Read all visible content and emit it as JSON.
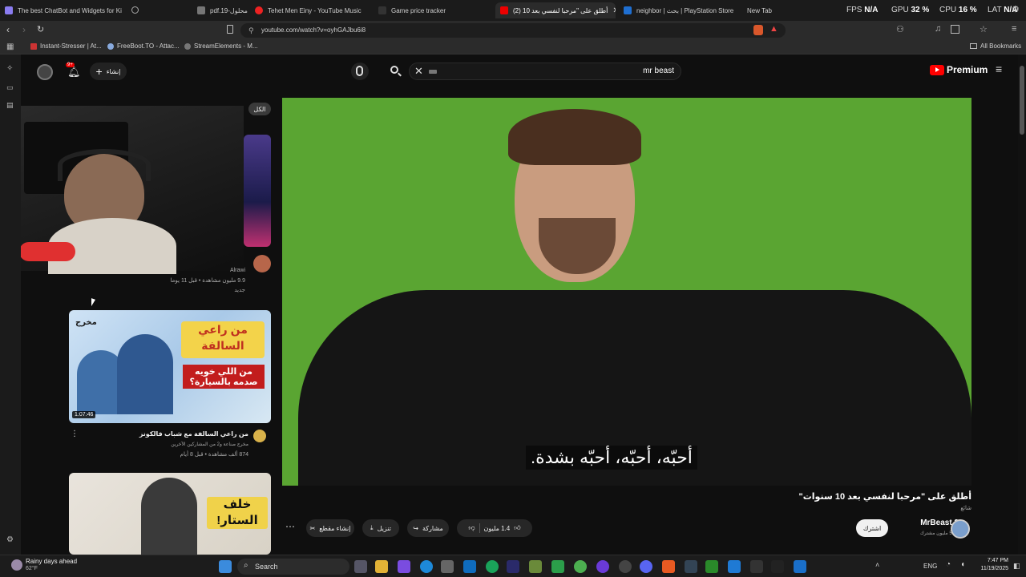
{
  "tabs": [
    {
      "label": "The best ChatBot and Widgets for Ki",
      "color": "#8a7cf0"
    },
    {
      "label": "pdf.محلول-19",
      "color": "#777"
    },
    {
      "label": "Tehet Men Einy - YouTube Music",
      "color": "#e22"
    },
    {
      "label": "Game price tracker",
      "color": "#333"
    },
    {
      "label": "أطلق على \"مرحبا لنفسي بعد 10 (2)",
      "color": "#e00",
      "active": true
    },
    {
      "label": "neighbor | بحث | PlayStation Store",
      "color": "#1f6fd1"
    },
    {
      "label": "New Tab",
      "color": "#555"
    }
  ],
  "stats": {
    "fps_label": "FPS",
    "fps_value": "N/A",
    "gpu_label": "GPU",
    "gpu_value": "32 %",
    "cpu_label": "CPU",
    "cpu_value": "16 %",
    "lat_label": "LAT",
    "lat_value": "N/A"
  },
  "address": {
    "url": "youtube.com/watch?v=oyhGAJbu6i8"
  },
  "bookmarks": {
    "items": [
      "Instant-Stresser | At...",
      "FreeBoot.TO - Attac...",
      "StreamElements - M..."
    ],
    "all_label": "All Bookmarks"
  },
  "yt_header": {
    "create_label": "إنشاء",
    "notif_count": "9+",
    "search_value": "mr beast",
    "premium_label": "Premium"
  },
  "sidebar": {
    "chip_label": "الكل",
    "video1": {
      "channel": "Alrawi",
      "meta": "9.9 مليون مشاهدة • قبل 11 يوما",
      "badge": "جديد"
    },
    "video2": {
      "duration": "1:07:46",
      "thumb_title": "من راعي السالفة",
      "thumb_sub": "من اللي خويه صدمه بالسيارة؟",
      "thumb_corner": "مخرج",
      "title": "من راعي السالفة مع شباب فالكونز",
      "channel": "مخرج صناعة و2 من المشاركين الآخرين",
      "meta": "874 ألف مشاهدة • قبل 8 أيام"
    },
    "video3": {
      "thumb_title": "خلف الستار!"
    }
  },
  "player": {
    "subtitle": "أحبّه، أحبّه، أحبّه بشدة.",
    "bg_color": "#5aa532"
  },
  "video": {
    "title": "أطلق على \"مرحبا لنفسي بعد 10 سنوات\"",
    "tag": "شائع",
    "channel": "MrBeast 2",
    "subs": "53.7 مليون مشترك",
    "subscribe_label": "اشترك",
    "likes": "1.4 مليون",
    "share_label": "مشاركة",
    "download_label": "تنزيل",
    "clip_label": "إنشاء مقطع"
  },
  "taskbar": {
    "weather_title": "Rainy days ahead",
    "weather_temp": "62°F",
    "search_label": "Search",
    "lang": "ENG",
    "time": "7:47 PM",
    "date": "11/19/2025"
  }
}
